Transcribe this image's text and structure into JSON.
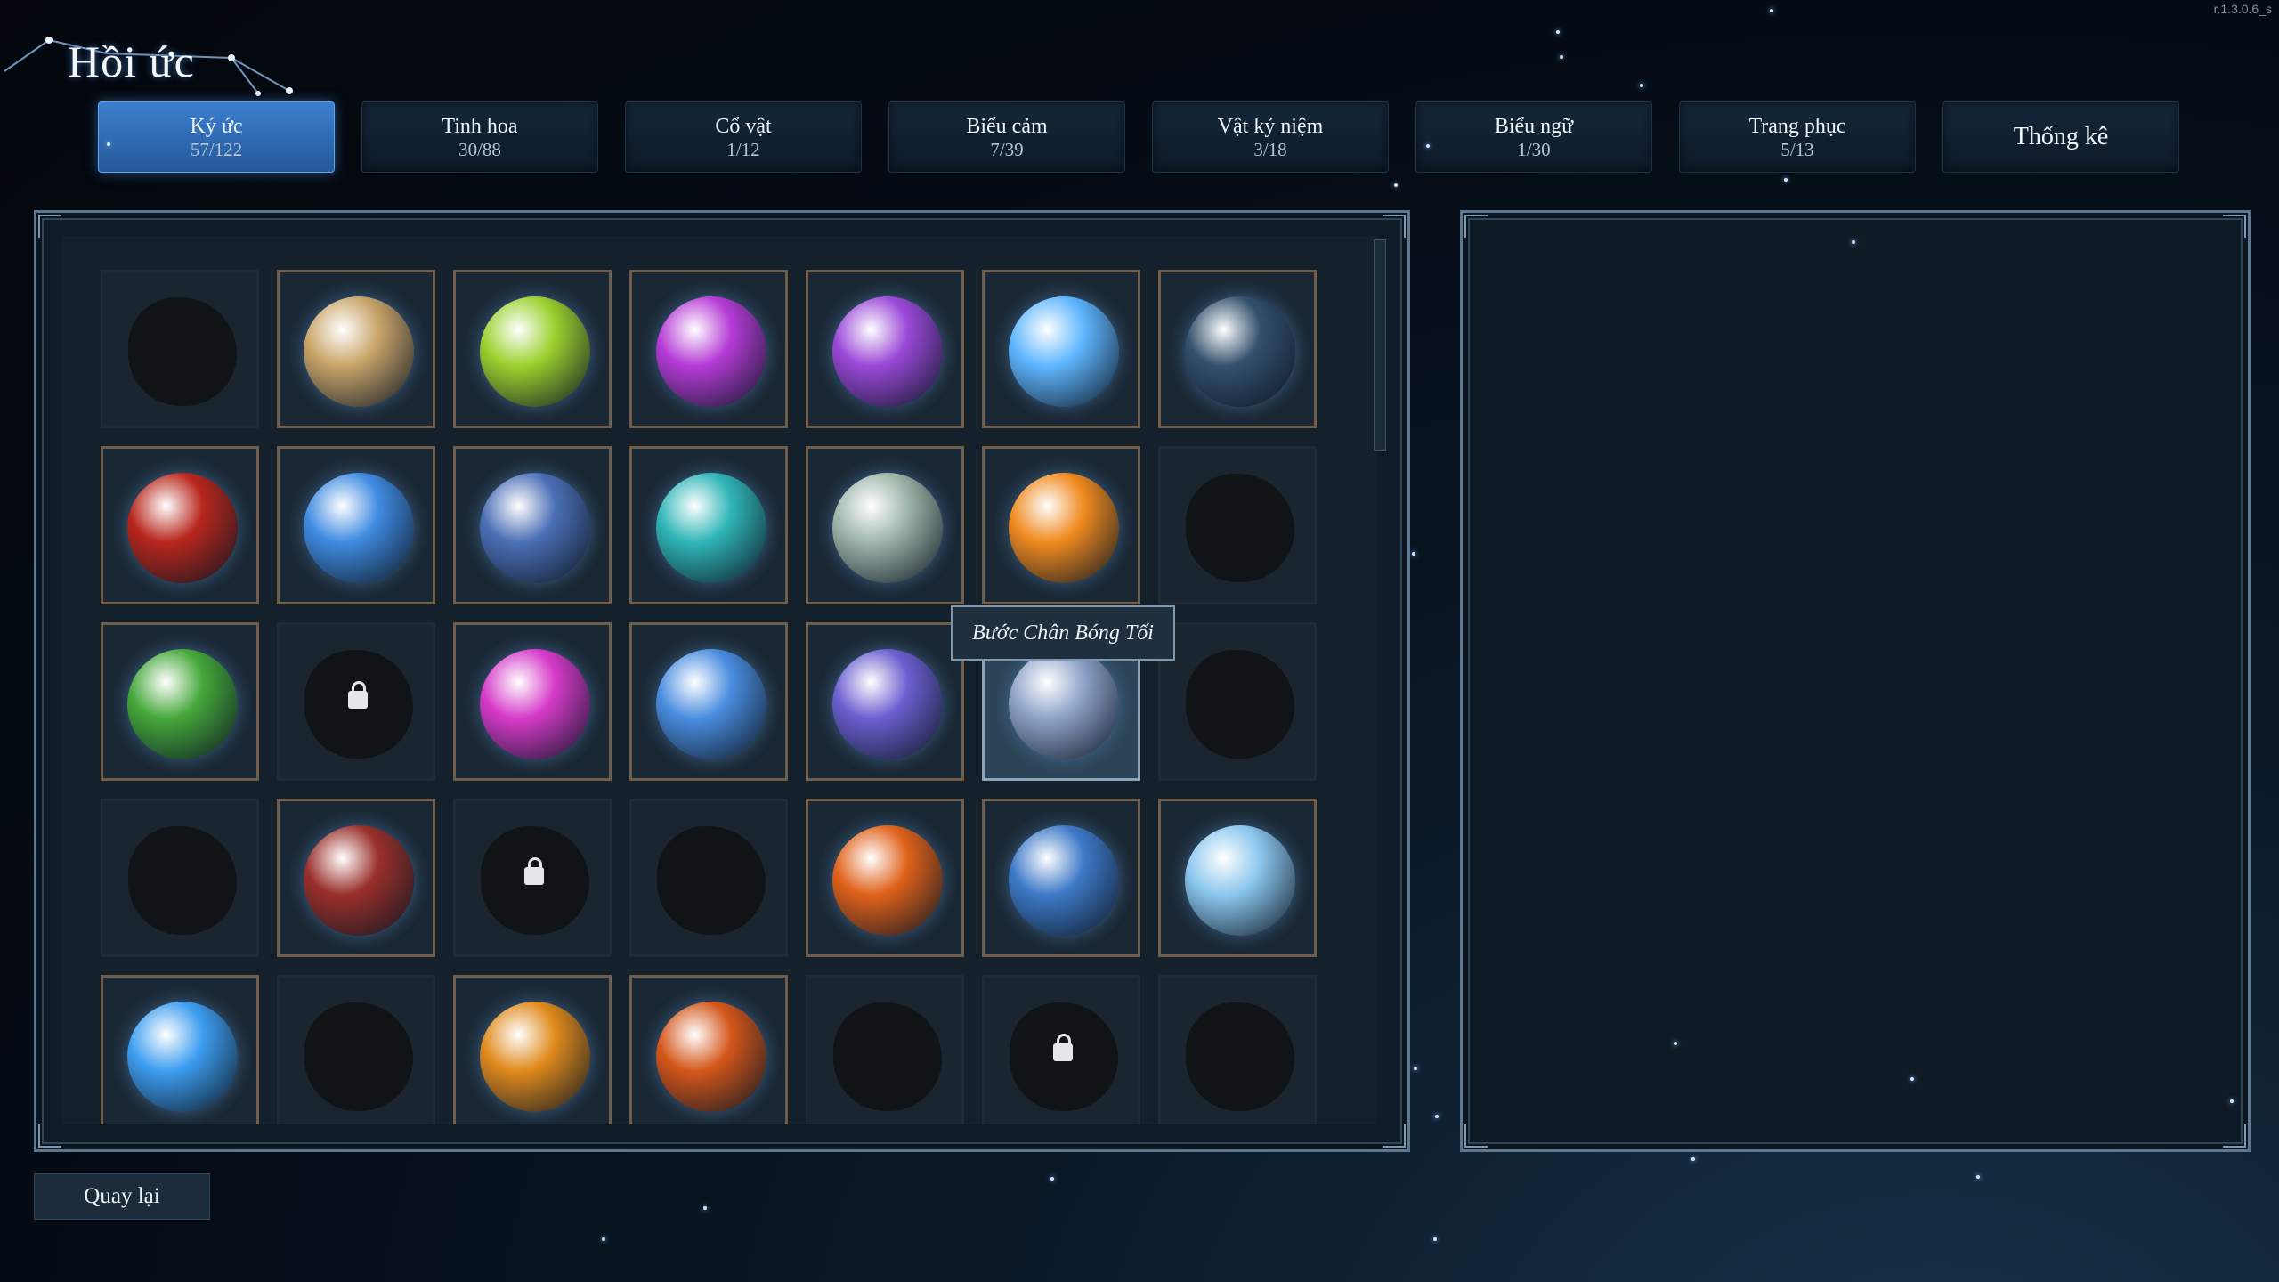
{
  "title": "Hồi ức",
  "version": "r.1.3.0.6_s",
  "tabs": [
    {
      "label": "Ký ức",
      "count": "57/122",
      "active": true
    },
    {
      "label": "Tinh hoa",
      "count": "30/88"
    },
    {
      "label": "Cổ vật",
      "count": "1/12"
    },
    {
      "label": "Biểu cảm",
      "count": "7/39"
    },
    {
      "label": "Vật kỷ niệm",
      "count": "3/18"
    },
    {
      "label": "Biểu ngữ",
      "count": "1/30"
    },
    {
      "label": "Trang phục",
      "count": "5/13"
    },
    {
      "label": "Thống kê",
      "count": ""
    }
  ],
  "tooltip": "Bước Chân Bóng Tối",
  "back_button": "Quay lại",
  "grid": [
    [
      {
        "state": "empty"
      },
      {
        "state": "filled",
        "icon": "swirl-sand-icon",
        "color": "#c9a469"
      },
      {
        "state": "filled",
        "icon": "green-skull-icon",
        "color": "#9bd12e"
      },
      {
        "state": "filled",
        "icon": "purple-crystal-icon",
        "color": "#b53bd6"
      },
      {
        "state": "filled",
        "icon": "purple-spike-icon",
        "color": "#9a48d8"
      },
      {
        "state": "filled",
        "icon": "snowflake-icon",
        "color": "#5fb6ff"
      },
      {
        "state": "filled",
        "icon": "shadow-demon-icon",
        "color": "#33506d"
      }
    ],
    [
      {
        "state": "filled",
        "icon": "red-dragon-icon",
        "color": "#b8261c"
      },
      {
        "state": "filled",
        "icon": "blue-shield-icon",
        "color": "#3f8be2"
      },
      {
        "state": "filled",
        "icon": "claw-strike-icon",
        "color": "#4b6fb6"
      },
      {
        "state": "filled",
        "icon": "teal-sparkle-icon",
        "color": "#2fb5b7"
      },
      {
        "state": "filled",
        "icon": "celtic-knot-icon",
        "color": "#9fb6aa"
      },
      {
        "state": "filled",
        "icon": "fire-burst-icon",
        "color": "#f08a1f"
      },
      {
        "state": "empty"
      }
    ],
    [
      {
        "state": "filled",
        "icon": "green-heal-icon",
        "color": "#45a83a"
      },
      {
        "state": "locked"
      },
      {
        "state": "filled",
        "icon": "pink-comet-icon",
        "color": "#d63ac9"
      },
      {
        "state": "filled",
        "icon": "blue-slash-icon",
        "color": "#4a8de0"
      },
      {
        "state": "filled",
        "icon": "violet-blade-icon",
        "color": "#6b5fd0"
      },
      {
        "state": "hover",
        "icon": "shadow-step-icon",
        "color": "#8ea3c9"
      },
      {
        "state": "empty"
      }
    ],
    [
      {
        "state": "empty"
      },
      {
        "state": "filled",
        "icon": "fanged-maw-icon",
        "color": "#9a2f2a"
      },
      {
        "state": "locked"
      },
      {
        "state": "empty"
      },
      {
        "state": "filled",
        "icon": "lava-swirl-icon",
        "color": "#e0611a"
      },
      {
        "state": "filled",
        "icon": "lightning-spear-icon",
        "color": "#3e79c8"
      },
      {
        "state": "filled",
        "icon": "ice-mace-icon",
        "color": "#8cc7ee"
      }
    ],
    [
      {
        "state": "filled",
        "icon": "ice-shard-icon",
        "color": "#3d9df0"
      },
      {
        "state": "empty"
      },
      {
        "state": "filled",
        "icon": "flaming-skull-icon",
        "color": "#e08a1c"
      },
      {
        "state": "filled",
        "icon": "fire-demon-icon",
        "color": "#d4561a"
      },
      {
        "state": "empty"
      },
      {
        "state": "locked"
      },
      {
        "state": "empty"
      }
    ]
  ]
}
